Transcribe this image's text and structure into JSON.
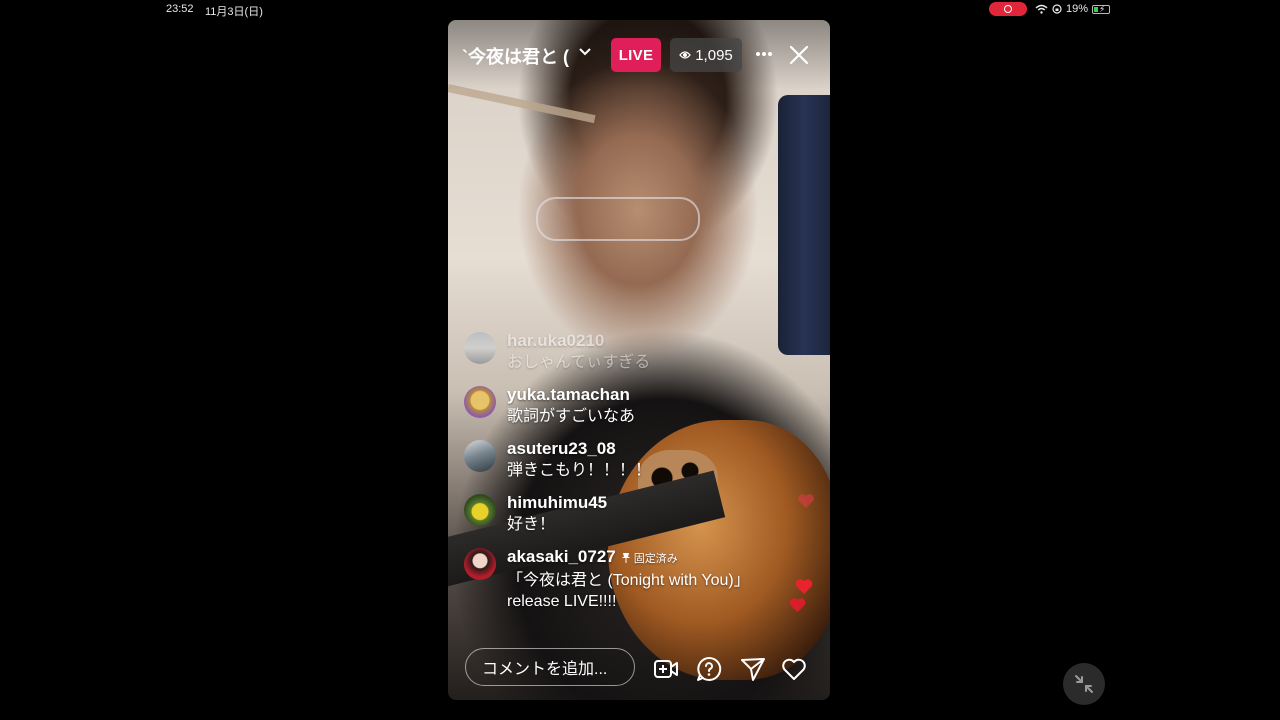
{
  "status_bar": {
    "time": "23:52",
    "date": "11月3日(日)",
    "battery": "19%",
    "recording_color": "#e0263a"
  },
  "live": {
    "title": "`今夜は君と (",
    "live_label": "LIVE",
    "viewer_count": "1,095",
    "live_color": "#e01e5a"
  },
  "comments": [
    {
      "username": "har.uka0210",
      "text": "おしゃんてぃすぎる",
      "faded": true
    },
    {
      "username": "yuka.tamachan",
      "text": "歌詞がすごいなあ"
    },
    {
      "username": "asuteru23_08",
      "text": "弾きこもり！！！！"
    },
    {
      "username": "himuhimu45",
      "text": "好き！"
    },
    {
      "username": "akasaki_0727",
      "pinned_label": "固定済み",
      "text": "「今夜は君と (Tonight with You)」",
      "text2": "release LIVE!!!!"
    }
  ],
  "bottom_bar": {
    "comment_placeholder": "コメントを追加..."
  },
  "icons": [
    "chevron-down-icon",
    "eye-icon",
    "more-icon",
    "close-icon",
    "pin-icon",
    "add-video-icon",
    "question-icon",
    "send-icon",
    "heart-icon",
    "minimize-icon"
  ]
}
